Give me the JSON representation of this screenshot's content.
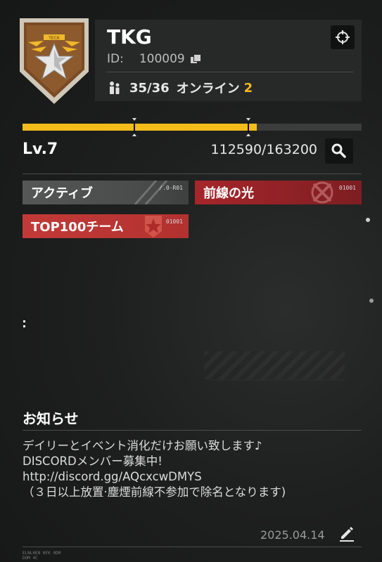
{
  "group": {
    "name": "TKG",
    "id_label": "ID:",
    "id_value": "100009",
    "members": "35/36",
    "online_label": "オンライン",
    "online_count": "2",
    "emblem_text": "TECK"
  },
  "level": {
    "label": "Lv.7",
    "exp": "112590/163200",
    "progress_fraction": 0.69
  },
  "tags": [
    {
      "label": "アクティブ",
      "code": "/.0-R01"
    },
    {
      "label": "前線の光",
      "code": "01001"
    },
    {
      "label": "TOP100チーム",
      "code": "01001"
    }
  ],
  "notice": {
    "heading": "お知らせ",
    "lines": [
      "デイリーとイベント消化だけお願い致します♪",
      "DISCORDメンバー募集中!",
      "http://discord.gg/AQcxcwDMYS",
      "（３日以上放置·塵煙前線不参加で除名となります)"
    ],
    "date": "2025.04.14"
  },
  "footer": {
    "fine_line1": "ELNLHEN NFK 0DM",
    "fine_line2": "DOM 4C"
  },
  "colors": {
    "accent": "#f4bc1a",
    "tag_red": "#a6262b",
    "tag_gray": "#555757"
  },
  "icons": {
    "copy": "copy-icon",
    "members": "people-icon",
    "target": "crosshair-icon",
    "search": "search-icon",
    "edit": "pencil-icon"
  }
}
